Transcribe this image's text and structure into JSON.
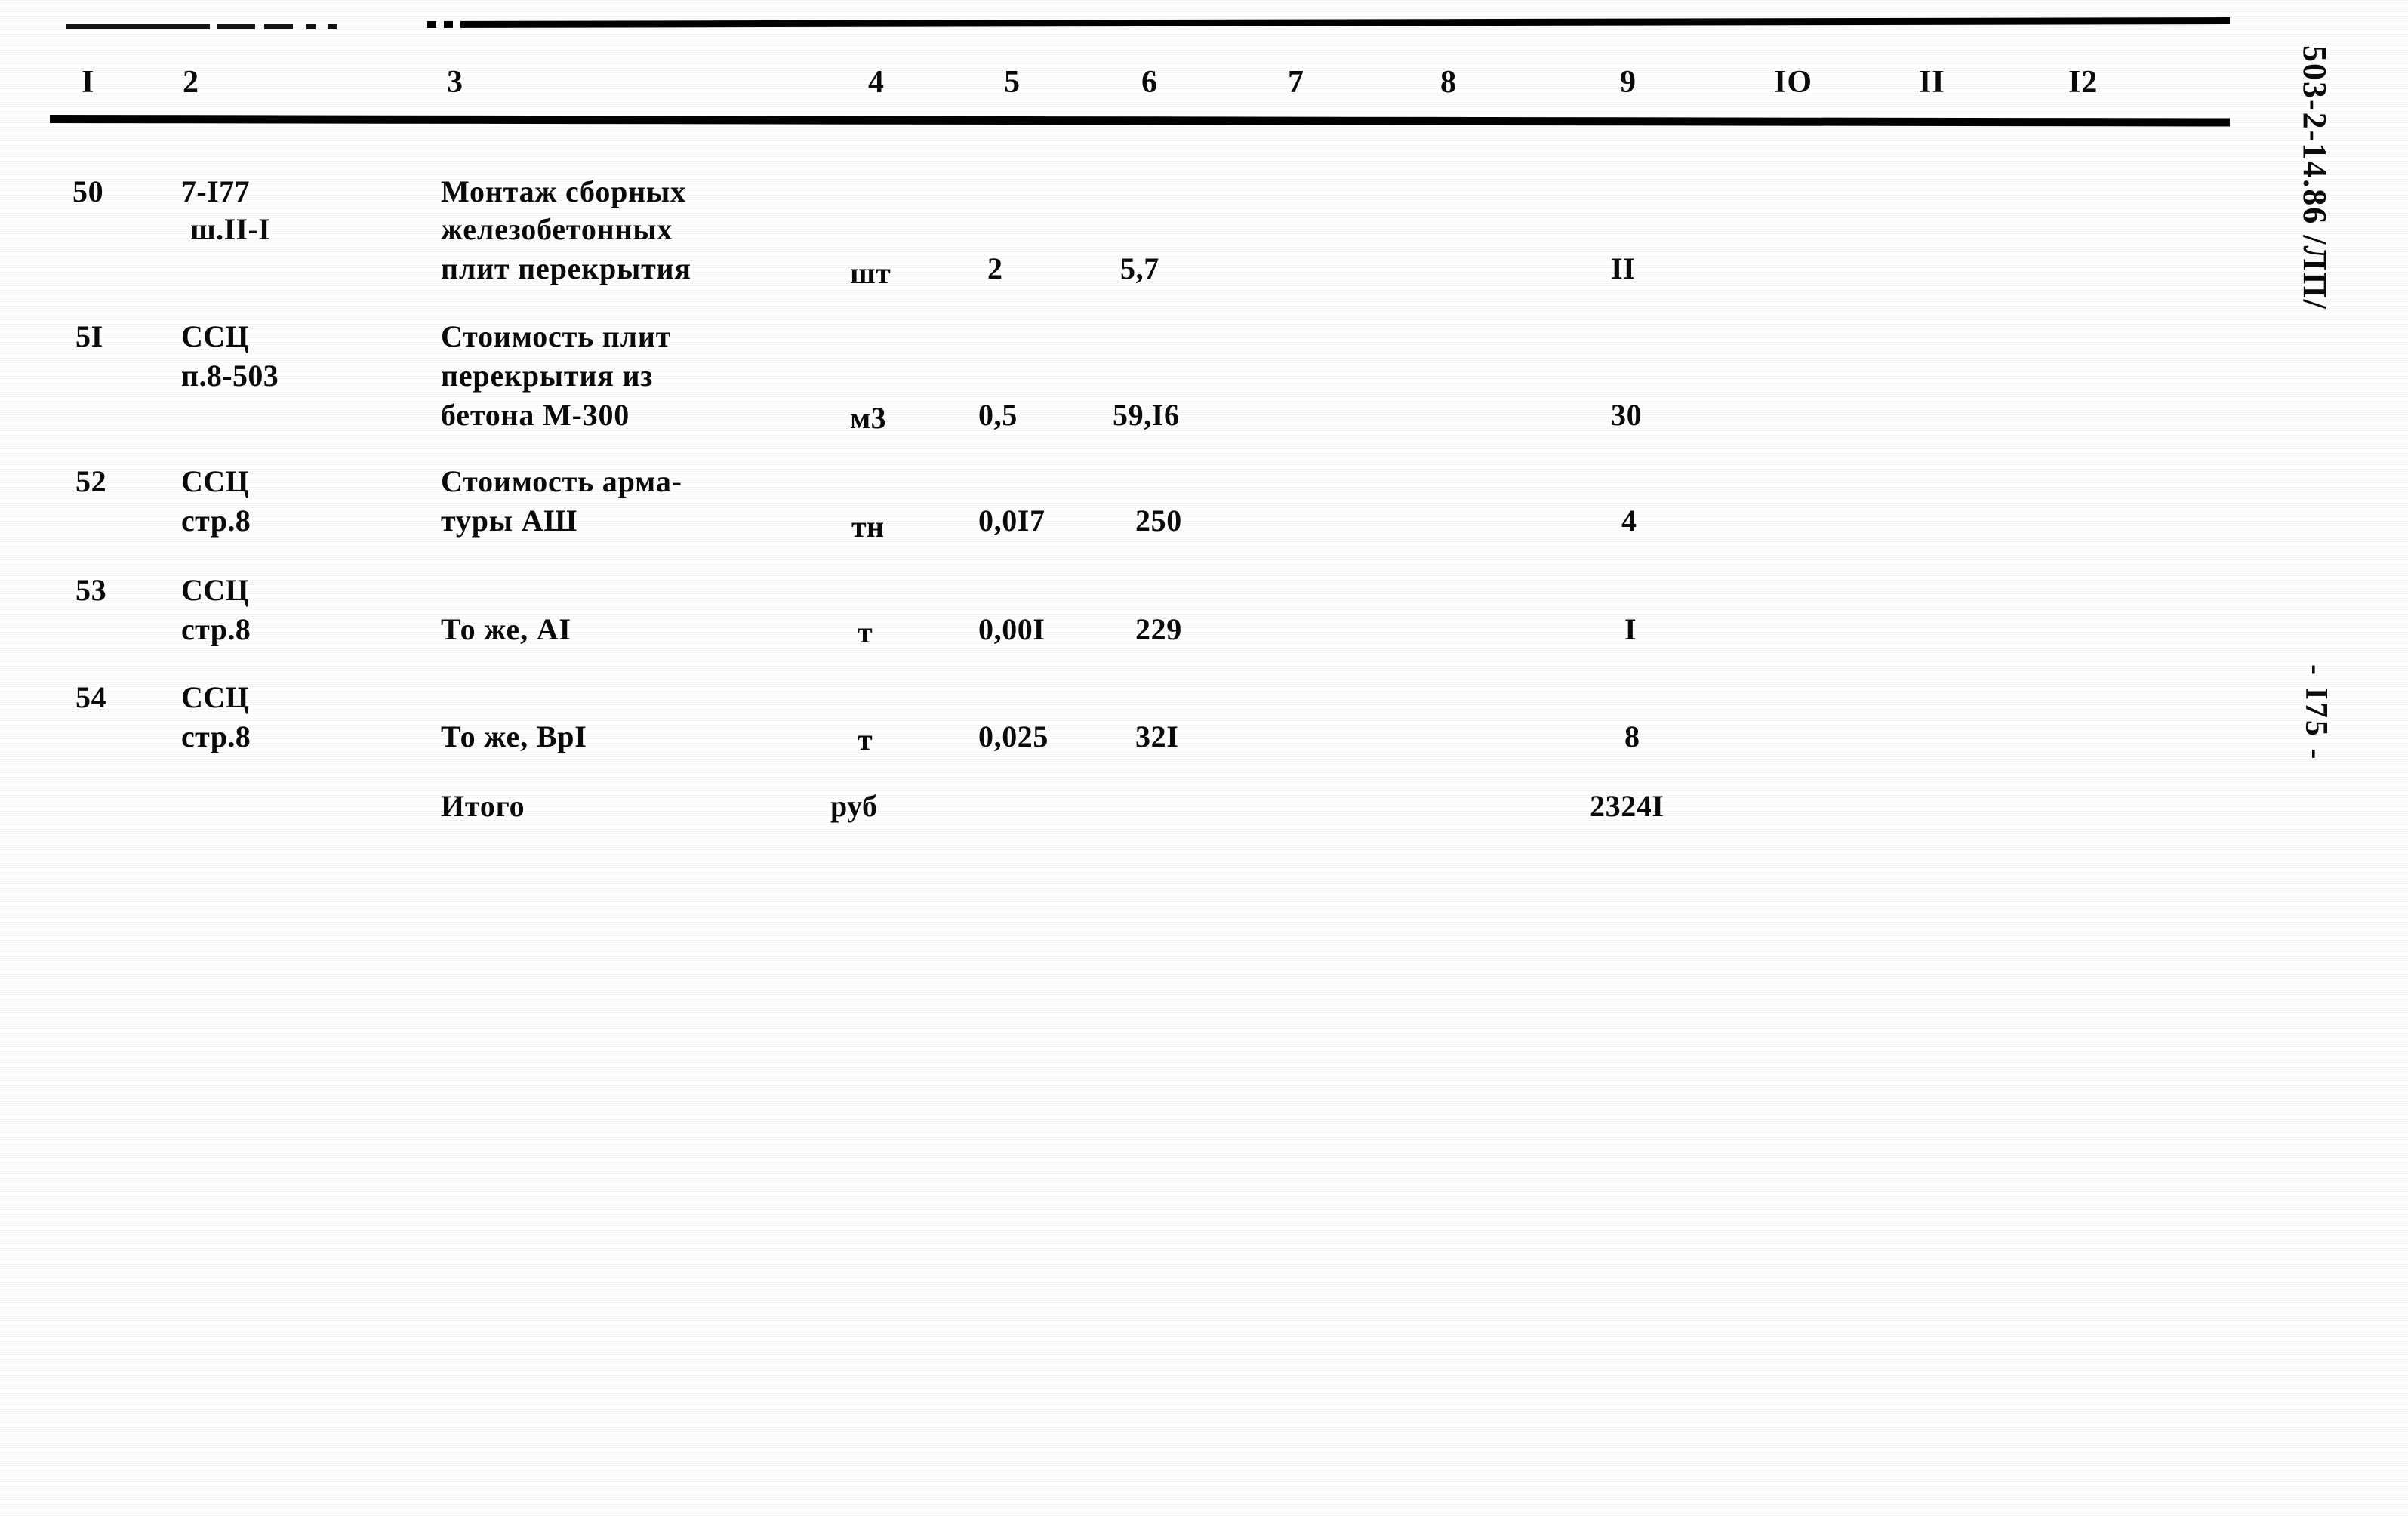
{
  "document": {
    "code_stamp": "503-2-14.86 /ЛП/",
    "page_number_stamp": "- I75 -"
  },
  "table": {
    "column_headers": [
      "I",
      "2",
      "3",
      "4",
      "5",
      "6",
      "7",
      "8",
      "9",
      "IO",
      "II",
      "I2"
    ],
    "rows": [
      {
        "num": "50",
        "code_lines": [
          "7-I77",
          "ш.II-I"
        ],
        "desc_lines": [
          "Монтаж сборных",
          "железобетонных",
          "плит перекрытия"
        ],
        "unit": "шт",
        "qty": "2",
        "price": "5,7",
        "c7": "",
        "c8": "",
        "total": "II",
        "c10": "",
        "c11": "",
        "c12": ""
      },
      {
        "num": "5I",
        "code_lines": [
          "ССЦ",
          "п.8-503"
        ],
        "desc_lines": [
          "Стоимость плит",
          "перекрытия из",
          "бетона М-300"
        ],
        "unit": "м3",
        "qty": "0,5",
        "price": "59,I6",
        "c7": "",
        "c8": "",
        "total": "30",
        "c10": "",
        "c11": "",
        "c12": ""
      },
      {
        "num": "52",
        "code_lines": [
          "ССЦ",
          "стр.8"
        ],
        "desc_lines": [
          "Стоимость арма-",
          "туры АШ"
        ],
        "unit": "тн",
        "qty": "0,0I7",
        "price": "250",
        "c7": "",
        "c8": "",
        "total": "4",
        "c10": "",
        "c11": "",
        "c12": ""
      },
      {
        "num": "53",
        "code_lines": [
          "ССЦ",
          "стр.8"
        ],
        "desc_lines": [
          "То же, АI"
        ],
        "unit": "т",
        "qty": "0,00I",
        "price": "229",
        "c7": "",
        "c8": "",
        "total": "I",
        "c10": "",
        "c11": "",
        "c12": ""
      },
      {
        "num": "54",
        "code_lines": [
          "ССЦ",
          "стр.8"
        ],
        "desc_lines": [
          "То же, ВрI"
        ],
        "unit": "т",
        "qty": "0,025",
        "price": "32I",
        "c7": "",
        "c8": "",
        "total": "8",
        "c10": "",
        "c11": "",
        "c12": ""
      }
    ],
    "summary_row": {
      "label": "Итого",
      "unit": "руб",
      "total": "2324I"
    }
  }
}
